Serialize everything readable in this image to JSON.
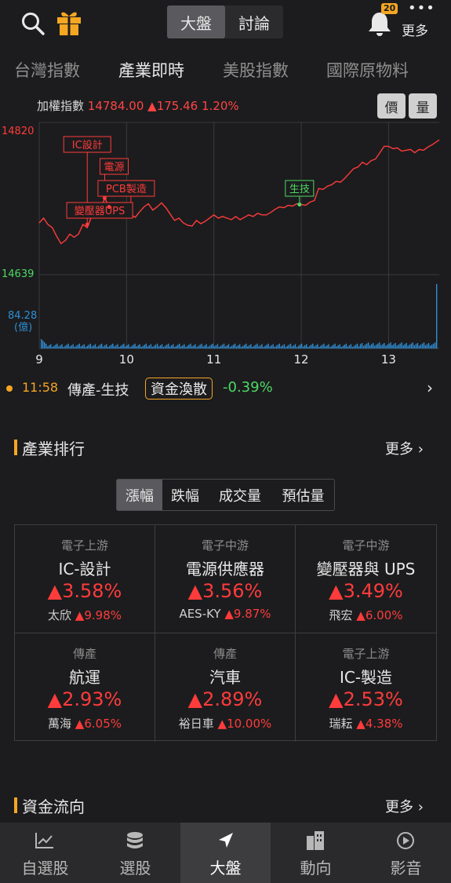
{
  "header": {
    "segments": [
      "大盤",
      "討論"
    ],
    "active_segment": "大盤",
    "notification_count": "20",
    "more_label": "更多",
    "more_dots": "•••"
  },
  "tabs": [
    "台灣指數",
    "產業即時",
    "美股指數",
    "國際原物料"
  ],
  "active_tab": "產業即時",
  "index": {
    "name": "加權指數",
    "value": "14784.00",
    "change": "▲175.46",
    "percent": "1.20%",
    "btn_price": "價",
    "btn_volume": "量"
  },
  "chart_data": {
    "type": "line",
    "price_axis": {
      "high_label": "14820",
      "low_label": "14639",
      "ylim": [
        14639,
        14820
      ]
    },
    "volume_axis": {
      "label": "84.28",
      "unit": "(億)",
      "max": 84.28
    },
    "x_ticks": [
      "9",
      "10",
      "11",
      "12",
      "13"
    ],
    "x_range": [
      9,
      13.58
    ],
    "series_price": [
      [
        9.0,
        14702
      ],
      [
        9.05,
        14708
      ],
      [
        9.1,
        14700
      ],
      [
        9.15,
        14696
      ],
      [
        9.2,
        14685
      ],
      [
        9.25,
        14676
      ],
      [
        9.3,
        14680
      ],
      [
        9.35,
        14688
      ],
      [
        9.4,
        14684
      ],
      [
        9.45,
        14688
      ],
      [
        9.5,
        14700
      ],
      [
        9.55,
        14696
      ],
      [
        9.6,
        14710
      ],
      [
        9.65,
        14722
      ],
      [
        9.7,
        14718
      ],
      [
        9.75,
        14733
      ],
      [
        9.8,
        14722
      ],
      [
        9.85,
        14714
      ],
      [
        9.9,
        14712
      ],
      [
        9.95,
        14708
      ],
      [
        10.0,
        14714
      ],
      [
        10.05,
        14712
      ],
      [
        10.1,
        14709
      ],
      [
        10.15,
        14716
      ],
      [
        10.2,
        14722
      ],
      [
        10.25,
        14726
      ],
      [
        10.3,
        14718
      ],
      [
        10.35,
        14722
      ],
      [
        10.4,
        14727
      ],
      [
        10.45,
        14721
      ],
      [
        10.5,
        14713
      ],
      [
        10.55,
        14705
      ],
      [
        10.6,
        14708
      ],
      [
        10.65,
        14702
      ],
      [
        10.7,
        14699
      ],
      [
        10.75,
        14698
      ],
      [
        10.8,
        14705
      ],
      [
        10.85,
        14701
      ],
      [
        10.9,
        14704
      ],
      [
        10.95,
        14708
      ],
      [
        11.0,
        14712
      ],
      [
        11.05,
        14708
      ],
      [
        11.1,
        14710
      ],
      [
        11.15,
        14708
      ],
      [
        11.2,
        14706
      ],
      [
        11.25,
        14710
      ],
      [
        11.3,
        14706
      ],
      [
        11.35,
        14709
      ],
      [
        11.4,
        14712
      ],
      [
        11.45,
        14710
      ],
      [
        11.5,
        14714
      ],
      [
        11.55,
        14712
      ],
      [
        11.6,
        14712
      ],
      [
        11.65,
        14715
      ],
      [
        11.7,
        14719
      ],
      [
        11.75,
        14722
      ],
      [
        11.8,
        14721
      ],
      [
        11.85,
        14724
      ],
      [
        11.9,
        14723
      ],
      [
        11.95,
        14726
      ],
      [
        12.0,
        14725
      ],
      [
        12.05,
        14724
      ],
      [
        12.1,
        14728
      ],
      [
        12.15,
        14730
      ],
      [
        12.2,
        14745
      ],
      [
        12.25,
        14744
      ],
      [
        12.3,
        14748
      ],
      [
        12.35,
        14750
      ],
      [
        12.4,
        14754
      ],
      [
        12.45,
        14753
      ],
      [
        12.5,
        14758
      ],
      [
        12.55,
        14764
      ],
      [
        12.6,
        14770
      ],
      [
        12.65,
        14772
      ],
      [
        12.7,
        14778
      ],
      [
        12.75,
        14775
      ],
      [
        12.8,
        14780
      ],
      [
        12.85,
        14782
      ],
      [
        12.9,
        14790
      ],
      [
        12.95,
        14798
      ],
      [
        13.0,
        14798
      ],
      [
        13.05,
        14795
      ],
      [
        13.1,
        14796
      ],
      [
        13.15,
        14792
      ],
      [
        13.2,
        14793
      ],
      [
        13.25,
        14794
      ],
      [
        13.3,
        14790
      ],
      [
        13.35,
        14794
      ],
      [
        13.4,
        14793
      ],
      [
        13.45,
        14797
      ],
      [
        13.5,
        14800
      ],
      [
        13.58,
        14806
      ]
    ],
    "annotations": [
      {
        "label": "IC設計",
        "x": 9.55,
        "y": 14700,
        "color": "#ff3b3b",
        "level": 0
      },
      {
        "label": "電源",
        "x": 9.75,
        "y": 14733,
        "color": "#ff3b3b",
        "level": 1
      },
      {
        "label": "PCB製造",
        "x": 10.05,
        "y": 14712,
        "color": "#ff3b3b",
        "level": 2
      },
      {
        "label": "變壓器UPS",
        "x": 9.8,
        "y": 14722,
        "color": "#ff3b3b",
        "level": 3
      },
      {
        "label": "生技",
        "x": 11.98,
        "y": 14725,
        "color": "#4cd964",
        "level": 2
      }
    ]
  },
  "ticker": {
    "time": "11:58",
    "name": "傳產-生技",
    "tag": "資金渙散",
    "change": "-0.39%"
  },
  "ranking": {
    "title": "產業排行",
    "more": "更多",
    "segments": [
      "漲幅",
      "跌幅",
      "成交量",
      "預估量"
    ],
    "active_segment": "漲幅",
    "cells": [
      {
        "cat": "電子上游",
        "name": "IC-設計",
        "pct": "▲3.58%",
        "stock": "太欣",
        "stock_pct": "▲9.98%"
      },
      {
        "cat": "電子中游",
        "name": "電源供應器",
        "pct": "▲3.56%",
        "stock": "AES-KY",
        "stock_pct": "▲9.87%"
      },
      {
        "cat": "電子中游",
        "name": "變壓器與 UPS",
        "pct": "▲3.49%",
        "stock": "飛宏",
        "stock_pct": "▲6.00%"
      },
      {
        "cat": "傳產",
        "name": "航運",
        "pct": "▲2.93%",
        "stock": "萬海",
        "stock_pct": "▲6.05%"
      },
      {
        "cat": "傳產",
        "name": "汽車",
        "pct": "▲2.89%",
        "stock": "裕日車",
        "stock_pct": "▲10.00%"
      },
      {
        "cat": "電子上游",
        "name": "IC-製造",
        "pct": "▲2.53%",
        "stock": "瑞耘",
        "stock_pct": "▲4.38%"
      }
    ]
  },
  "flow": {
    "title": "資金流向",
    "more": "更多"
  },
  "bottom_nav": [
    {
      "label": "自選股",
      "icon": "chart-line-icon"
    },
    {
      "label": "選股",
      "icon": "database-icon"
    },
    {
      "label": "大盤",
      "icon": "navigation-arrow-icon"
    },
    {
      "label": "動向",
      "icon": "building-icon"
    },
    {
      "label": "影音",
      "icon": "play-icon"
    }
  ],
  "active_nav": "大盤",
  "colors": {
    "up": "#ff3b3b",
    "down": "#4cd964",
    "accent": "#f5a623",
    "volume": "#2f8fd8"
  }
}
